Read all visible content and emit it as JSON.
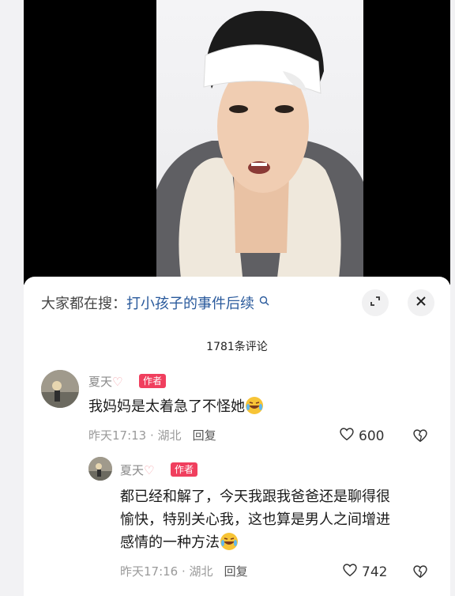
{
  "search": {
    "label": "大家都在搜：",
    "query": "打小孩子的事件后续"
  },
  "comments_header": {
    "count_label": "1781条评论"
  },
  "comments": [
    {
      "username": "夏天",
      "username_emoji": "🩷",
      "badge": "作者",
      "text": "我妈妈是太着急了不怪她",
      "time": "昨天17:13",
      "location": "湖北",
      "reply_label": "回复",
      "likes": "600"
    },
    {
      "username": "夏天",
      "username_emoji": "🩷",
      "badge": "作者",
      "text_lines": [
        "都已经和解了，今天我跟我爸爸还是聊得很",
        "愉快，特别关心我，这也算是男人之间增进",
        "感情的一种方法"
      ],
      "time": "昨天17:16",
      "location": "湖北",
      "reply_label": "回复",
      "likes": "742"
    }
  ],
  "meta_separator": " · ",
  "icons": {
    "search_hint": "search-icon",
    "expand": "expand-icon",
    "close": "close-icon",
    "like": "heart-icon",
    "dislike": "broken-heart-icon",
    "laugh": "laughing-tears-emoji"
  },
  "colors": {
    "author_badge": "#f03f5e",
    "search_query": "#2a5a9c"
  }
}
